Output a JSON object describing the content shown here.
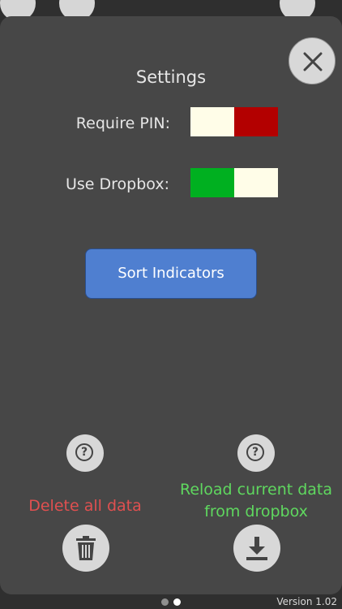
{
  "settings": {
    "title": "Settings",
    "require_pin_label": "Require PIN:",
    "use_dropbox_label": "Use Dropbox:",
    "sort_indicators_label": "Sort Indicators"
  },
  "toggles": {
    "require_pin": {
      "left_color": "#fffde8",
      "right_color": "#b30000"
    },
    "use_dropbox": {
      "left_color": "#00b020",
      "right_color": "#fffde8"
    }
  },
  "actions": {
    "delete_label": "Delete all data",
    "reload_label_line1": "Reload current data",
    "reload_label_line2": "from dropbox",
    "delete_color": "#e05050",
    "reload_color": "#5fd85f"
  },
  "icons": {
    "close": "close-icon",
    "help": "question-mark-icon",
    "trash": "trash-icon",
    "download": "download-icon"
  },
  "pager": {
    "page_count": 2,
    "active_index": 1
  },
  "footer": {
    "version": "Version 1.02"
  }
}
